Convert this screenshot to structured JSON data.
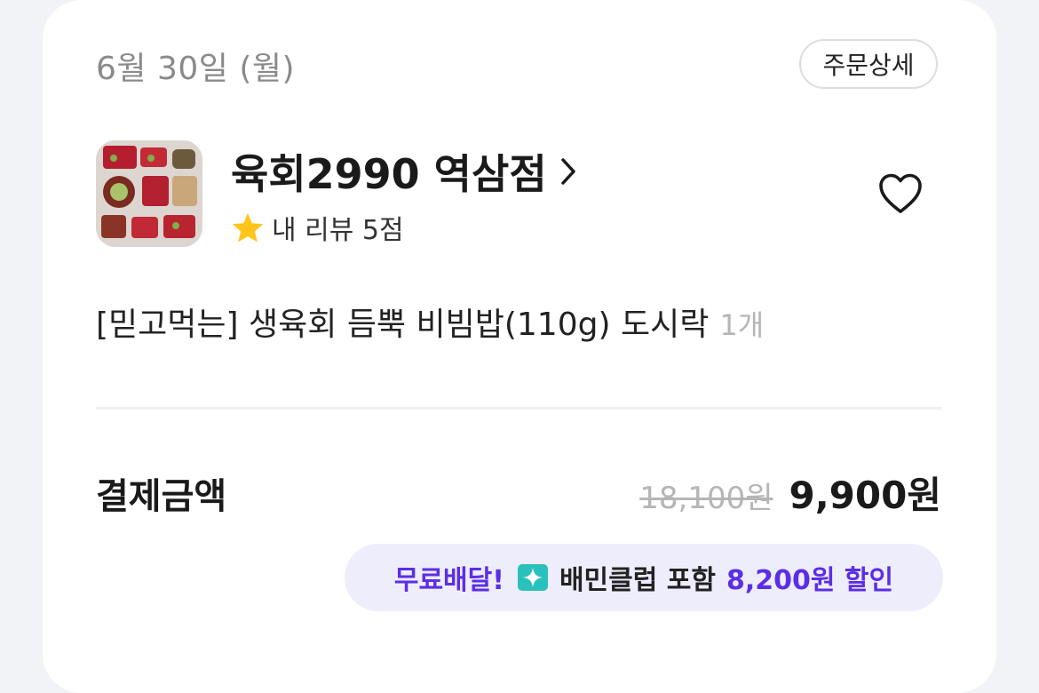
{
  "order": {
    "date": "6월 30일 (월)",
    "detail_button": "주문상세"
  },
  "store": {
    "name": "육회2990 역삼점",
    "review_label": "내 리뷰 5점",
    "thumbnail_icon": "food-photo",
    "favorite_icon": "heart-outline-icon"
  },
  "item": {
    "name": "[믿고먹는] 생육회 듬뿍 비빔밥(110g) 도시락",
    "quantity": "1개"
  },
  "payment": {
    "label": "결제금액",
    "original_price": "18,100원",
    "final_price": "9,900원"
  },
  "promo": {
    "free_delivery": "무료배달!",
    "club_text": "배민클럽 포함",
    "discount_text": "8,200원 할인",
    "accent_color": "#5b2ee6",
    "club_icon_color": "#2ac1bc"
  }
}
